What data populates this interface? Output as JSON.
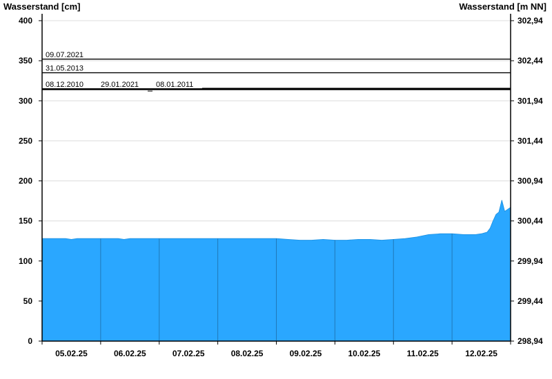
{
  "chart_data": {
    "type": "area",
    "title": "",
    "ylabel_left": "Wasserstand [cm]",
    "ylabel_right": "Wasserstand [m NN]",
    "ylim": [
      0,
      400
    ],
    "yticks_left": [
      0,
      50,
      100,
      150,
      200,
      250,
      300,
      350,
      400
    ],
    "yticks_right": [
      "298,94",
      "299,44",
      "299,94",
      "300,44",
      "300,94",
      "301,44",
      "301,94",
      "302,44",
      "302,94"
    ],
    "xlim": [
      0,
      8
    ],
    "xtick_labels": [
      "05.02.25",
      "06.02.25",
      "07.02.25",
      "08.02.25",
      "09.02.25",
      "10.02.25",
      "11.02.25",
      "12.02.25"
    ],
    "grid": true,
    "fill_color": "#2aa7ff",
    "reference_lines": [
      {
        "label": "09.07.2021",
        "value": 352
      },
      {
        "label": "31.05.2013",
        "value": 335
      },
      {
        "label": "08.12.2010",
        "value": 315
      },
      {
        "label": "29.01.2021",
        "value": 313
      },
      {
        "label": "08.01.2011",
        "value": 313
      }
    ],
    "series": [
      {
        "x": [
          0,
          0.4,
          0.5,
          0.6,
          1.0,
          1.3,
          1.4,
          1.5,
          2.0,
          3.0,
          4.0,
          4.2,
          4.4,
          4.6,
          4.8,
          5.0,
          5.2,
          5.4,
          5.6,
          5.8,
          6.0,
          6.2,
          6.4,
          6.6,
          6.8,
          7.0,
          7.2,
          7.4,
          7.5,
          7.6,
          7.65,
          7.7,
          7.75,
          7.8,
          7.85,
          7.9,
          8.0
        ],
        "values": [
          128,
          128,
          127,
          128,
          128,
          128,
          127,
          128,
          128,
          128,
          128,
          127,
          126,
          126,
          127,
          126,
          126,
          127,
          127,
          126,
          127,
          128,
          130,
          133,
          134,
          134,
          133,
          133,
          134,
          136,
          141,
          150,
          158,
          161,
          176,
          162,
          167
        ]
      }
    ]
  }
}
